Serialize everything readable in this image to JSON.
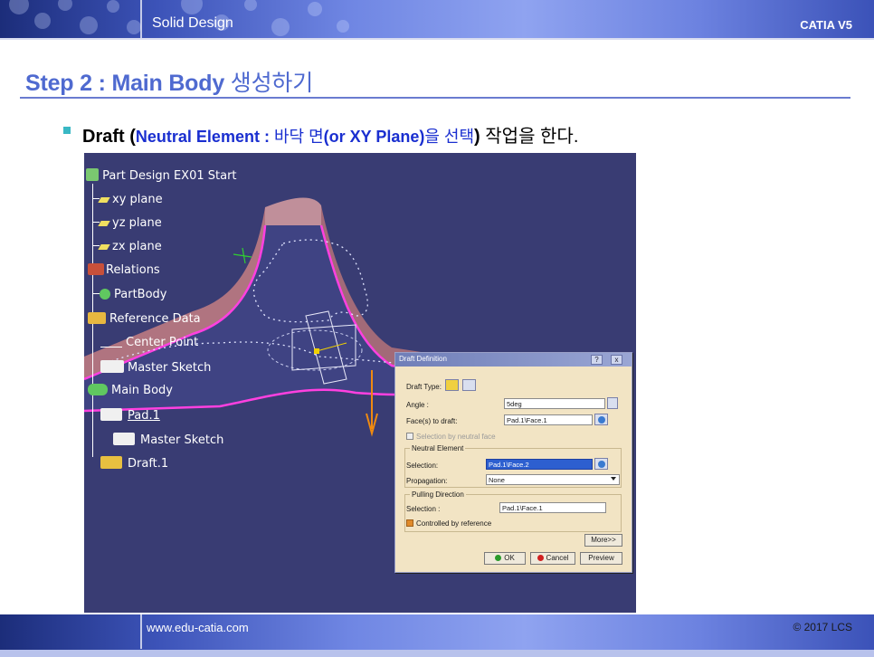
{
  "header": {
    "title": "Solid Design",
    "product": "CATIA V5"
  },
  "page": {
    "title_en": "Step 2 : Main Body",
    "title_kr": "생성하기",
    "bullet": {
      "bold_term": "Draft",
      "paren_open": "(",
      "note_bold": "Neutral Element : ",
      "note_kr": "바닥 면",
      "note_bold2": "(or XY Plane)",
      "note_kr2": "을 선택",
      "paren_close": ")",
      "tail": "작업을 한다."
    }
  },
  "tree": {
    "items": [
      "Part Design EX01 Start",
      "xy plane",
      "yz plane",
      "zx plane",
      "Relations",
      "PartBody",
      "Reference Data",
      "Center Point",
      "Master Sketch",
      "Main Body",
      "Pad.1",
      "Master Sketch",
      "Draft.1"
    ]
  },
  "dialog": {
    "title": "Draft Definition",
    "help_btn": "?",
    "close_btn": "x",
    "draft_type_label": "Draft Type:",
    "angle_label": "Angle :",
    "angle_value": "5deg",
    "faces_label": "Face(s) to draft:",
    "faces_value": "Pad.1\\Face.1",
    "selection_by_neutral": "Selection by neutral face",
    "neutral_group": "Neutral Element",
    "neutral_selection_label": "Selection:",
    "neutral_selection_value": "Pad.1\\Face.2",
    "propagation_label": "Propagation:",
    "propagation_value": "None",
    "pulling_group": "Pulling Direction",
    "pulling_selection_label": "Selection :",
    "pulling_selection_value": "Pad.1\\Face.1",
    "controlled_by_reference": "Controlled by reference",
    "more_btn": "More>>",
    "ok_btn": "OK",
    "cancel_btn": "Cancel",
    "preview_btn": "Preview"
  },
  "footer": {
    "url": "www.edu-catia.com",
    "copyright": "© 2017 LCS"
  },
  "colors": {
    "title_blue": "#4f6ad0",
    "note_blue": "#1a2fd0",
    "viewport_bg": "#393c73",
    "dialog_bg": "#f2e4c4",
    "selection_blue": "#2d5fd0"
  }
}
